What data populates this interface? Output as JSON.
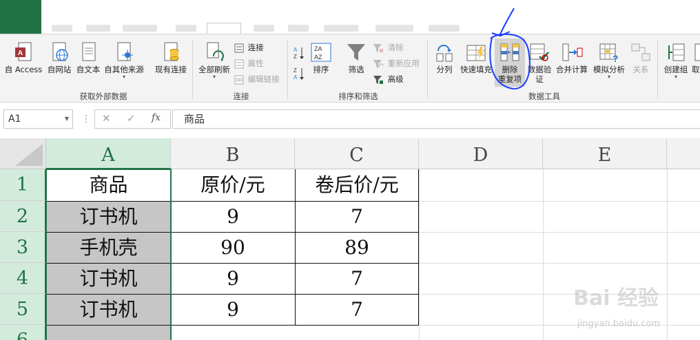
{
  "ribbon": {
    "external_data": {
      "group_label": "获取外部数据",
      "buttons": [
        {
          "label": "自 Access",
          "icon": "access-icon"
        },
        {
          "label": "自网站",
          "icon": "web-icon"
        },
        {
          "label": "自文本",
          "icon": "text-file-icon"
        },
        {
          "label": "自其他来源",
          "icon": "other-sources-icon"
        },
        {
          "label": "现有连接",
          "icon": "existing-connections-icon"
        }
      ]
    },
    "connections": {
      "group_label": "连接",
      "refresh_all": "全部刷新",
      "connections": "连接",
      "properties": "属性",
      "edit_links": "编辑链接"
    },
    "sort_filter": {
      "group_label": "排序和筛选",
      "sort": "排序",
      "filter": "筛选",
      "clear": "清除",
      "reapply": "重新应用",
      "advanced": "高级"
    },
    "data_tools": {
      "group_label": "数据工具",
      "text_to_columns": "分列",
      "flash_fill": "快速填充",
      "remove_duplicates_1": "删除",
      "remove_duplicates_2": "重复项",
      "data_validation_1": "数据验",
      "data_validation_2": "证",
      "consolidate": "合并计算",
      "what_if": "模拟分析",
      "relationships": "关系"
    },
    "outline": {
      "group": "创建组",
      "ungroup": "取"
    }
  },
  "formula_bar": {
    "name_box": "A1",
    "cancel": "✕",
    "enter": "✓",
    "fx": "fx",
    "content": "商品"
  },
  "sheet": {
    "columns": [
      "A",
      "B",
      "C",
      "D",
      "E"
    ],
    "rows": [
      "1",
      "2",
      "3",
      "4",
      "5",
      "6"
    ],
    "cells": [
      [
        "商品",
        "原价/元",
        "卷后价/元"
      ],
      [
        "订书机",
        "9",
        "7"
      ],
      [
        "手机壳",
        "90",
        "89"
      ],
      [
        "订书机",
        "9",
        "7"
      ],
      [
        "订书机",
        "9",
        "7"
      ]
    ]
  },
  "watermark": {
    "brand": "Bai 经验",
    "url": "jingyan.baidu.com"
  },
  "colors": {
    "excel_green": "#217346",
    "annotation_blue": "#1a3cff",
    "selected_fill": "#c6c6c6"
  }
}
